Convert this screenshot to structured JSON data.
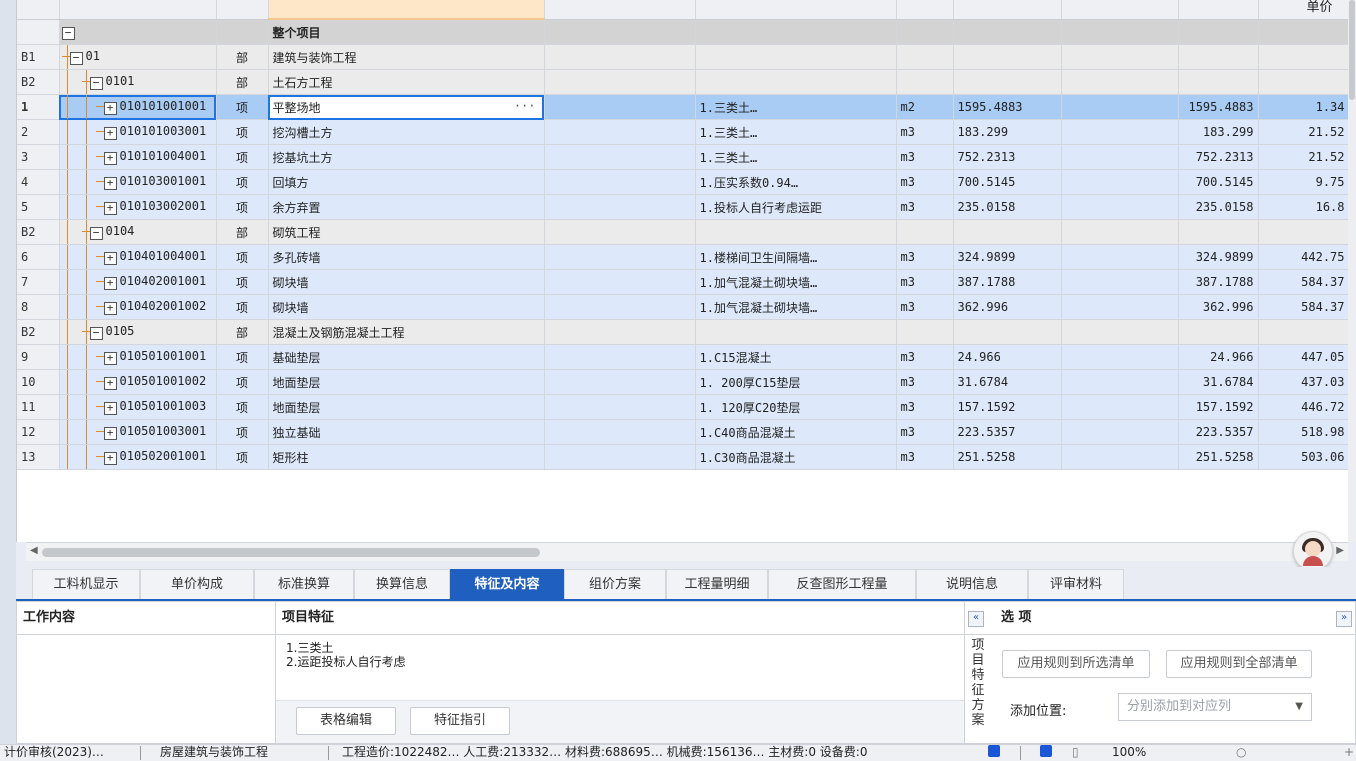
{
  "header": {
    "price_col": "单价"
  },
  "rows": [
    {
      "type": "proj",
      "num": "",
      "code": "",
      "kind": "",
      "name": "整个项目",
      "feat": "",
      "unit": "",
      "qty": "",
      "qty2": "",
      "price": ""
    },
    {
      "type": "fb",
      "num": "B1",
      "code": "01",
      "kind": "部",
      "name": "建筑与装饰工程",
      "feat": "",
      "unit": "",
      "qty": "",
      "qty2": "",
      "price": ""
    },
    {
      "type": "fb",
      "num": "B2",
      "code": "0101",
      "kind": "部",
      "name": "土石方工程",
      "feat": "",
      "unit": "",
      "qty": "",
      "qty2": "",
      "price": ""
    },
    {
      "type": "sel",
      "num": "1",
      "code": "010101001001",
      "kind": "项",
      "name": "平整场地",
      "feat": "1.三类土…",
      "unit": "m2",
      "qty": "1595.4883",
      "qty2": "1595.4883",
      "price": "1.34"
    },
    {
      "type": "item",
      "num": "2",
      "code": "010101003001",
      "kind": "项",
      "name": "挖沟槽土方",
      "feat": "1.三类土…",
      "unit": "m3",
      "qty": "183.299",
      "qty2": "183.299",
      "price": "21.52"
    },
    {
      "type": "item",
      "num": "3",
      "code": "010101004001",
      "kind": "项",
      "name": "挖基坑土方",
      "feat": "1.三类土…",
      "unit": "m3",
      "qty": "752.2313",
      "qty2": "752.2313",
      "price": "21.52"
    },
    {
      "type": "item",
      "num": "4",
      "code": "010103001001",
      "kind": "项",
      "name": "回填方",
      "feat": "1.压实系数0.94…",
      "unit": "m3",
      "qty": "700.5145",
      "qty2": "700.5145",
      "price": "9.75"
    },
    {
      "type": "item",
      "num": "5",
      "code": "010103002001",
      "kind": "项",
      "name": "余方弃置",
      "feat": "1.投标人自行考虑运距",
      "unit": "m3",
      "qty": "235.0158",
      "qty2": "235.0158",
      "price": "16.8"
    },
    {
      "type": "fb",
      "num": "B2",
      "code": "0104",
      "kind": "部",
      "name": "砌筑工程",
      "feat": "",
      "unit": "",
      "qty": "",
      "qty2": "",
      "price": ""
    },
    {
      "type": "item",
      "num": "6",
      "code": "010401004001",
      "kind": "项",
      "name": "多孔砖墙",
      "feat": "1.楼梯间卫生间隔墙…",
      "unit": "m3",
      "qty": "324.9899",
      "qty2": "324.9899",
      "price": "442.75"
    },
    {
      "type": "item",
      "num": "7",
      "code": "010402001001",
      "kind": "项",
      "name": "砌块墙",
      "feat": "1.加气混凝土砌块墙…",
      "unit": "m3",
      "qty": "387.1788",
      "qty2": "387.1788",
      "price": "584.37"
    },
    {
      "type": "item",
      "num": "8",
      "code": "010402001002",
      "kind": "项",
      "name": "砌块墙",
      "feat": "1.加气混凝土砌块墙…",
      "unit": "m3",
      "qty": "362.996",
      "qty2": "362.996",
      "price": "584.37"
    },
    {
      "type": "fb",
      "num": "B2",
      "code": "0105",
      "kind": "部",
      "name": "混凝土及钢筋混凝土工程",
      "feat": "",
      "unit": "",
      "qty": "",
      "qty2": "",
      "price": ""
    },
    {
      "type": "item",
      "num": "9",
      "code": "010501001001",
      "kind": "项",
      "name": "基础垫层",
      "feat": "1.C15混凝土",
      "unit": "m3",
      "qty": "24.966",
      "qty2": "24.966",
      "price": "447.05"
    },
    {
      "type": "item",
      "num": "10",
      "code": "010501001002",
      "kind": "项",
      "name": "地面垫层",
      "feat": "1. 200厚C15垫层",
      "unit": "m3",
      "qty": "31.6784",
      "qty2": "31.6784",
      "price": "437.03"
    },
    {
      "type": "item",
      "num": "11",
      "code": "010501001003",
      "kind": "项",
      "name": "地面垫层",
      "feat": "1. 120厚C20垫层",
      "unit": "m3",
      "qty": "157.1592",
      "qty2": "157.1592",
      "price": "446.72"
    },
    {
      "type": "item",
      "num": "12",
      "code": "010501003001",
      "kind": "项",
      "name": "独立基础",
      "feat": "1.C40商品混凝土",
      "unit": "m3",
      "qty": "223.5357",
      "qty2": "223.5357",
      "price": "518.98"
    },
    {
      "type": "item",
      "num": "13",
      "code": "010502001001",
      "kind": "项",
      "name": "矩形柱",
      "feat": "1.C30商品混凝土",
      "unit": "m3",
      "qty": "251.5258",
      "qty2": "251.5258",
      "price": "503.06"
    }
  ],
  "tabs": [
    "工料机显示",
    "单价构成",
    "标准换算",
    "换算信息",
    "特征及内容",
    "组价方案",
    "工程量明细",
    "反查图形工程量",
    "说明信息",
    "评审材料"
  ],
  "active_tab": "特征及内容",
  "work": {
    "title": "工作内容"
  },
  "feature": {
    "title": "项目特征",
    "text": "1.三类土\n2.运距投标人自行考虑",
    "btn_table": "表格编辑",
    "btn_guide": "特征指引"
  },
  "options": {
    "collapse": "«",
    "title": "选 项",
    "expand": "»",
    "side_label": "项目特征方案",
    "btn_selected": "应用规则到所选清单",
    "btn_all": "应用规则到全部清单",
    "position_label": "添加位置:",
    "position_value": "分别添加到对应列"
  },
  "status": {
    "s1": "计价审核(2023)…",
    "s2": "房屋建筑与装饰工程",
    "s3": "工程造价:1022482…  人工费:213332…  材料费:688695…  机械费:156136…  主材费:0  设备费:0",
    "zoom": "100%"
  }
}
